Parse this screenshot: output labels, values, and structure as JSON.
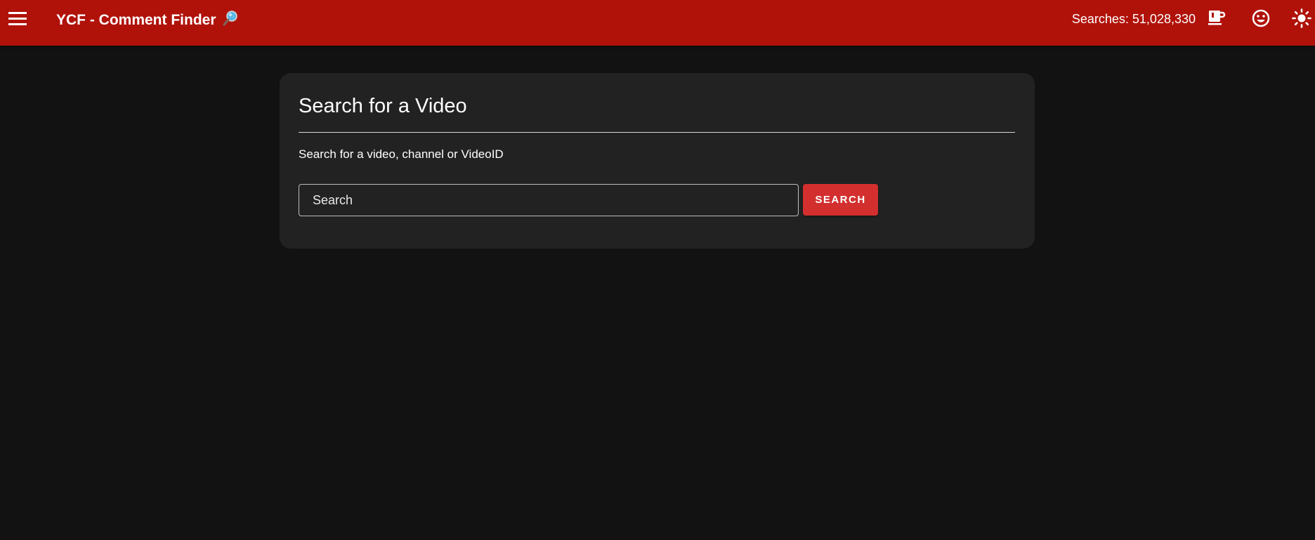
{
  "header": {
    "title": "YCF - Comment Finder",
    "title_icon": "magnifier-icon",
    "searches_label": "Searches: 51,028,330",
    "icons": [
      "menu-icon",
      "coffee-cup-icon",
      "smiley-face-icon",
      "sun-icon"
    ],
    "background_color": "#b0120a"
  },
  "card": {
    "title": "Search for a Video",
    "subtitle": "Search for a video, channel or VideoID",
    "search_placeholder": "Search",
    "search_value": "",
    "search_button_label": "SEARCH",
    "button_color": "#d32f2f"
  },
  "theme": {
    "page_background": "#121212",
    "card_background": "#222222"
  }
}
